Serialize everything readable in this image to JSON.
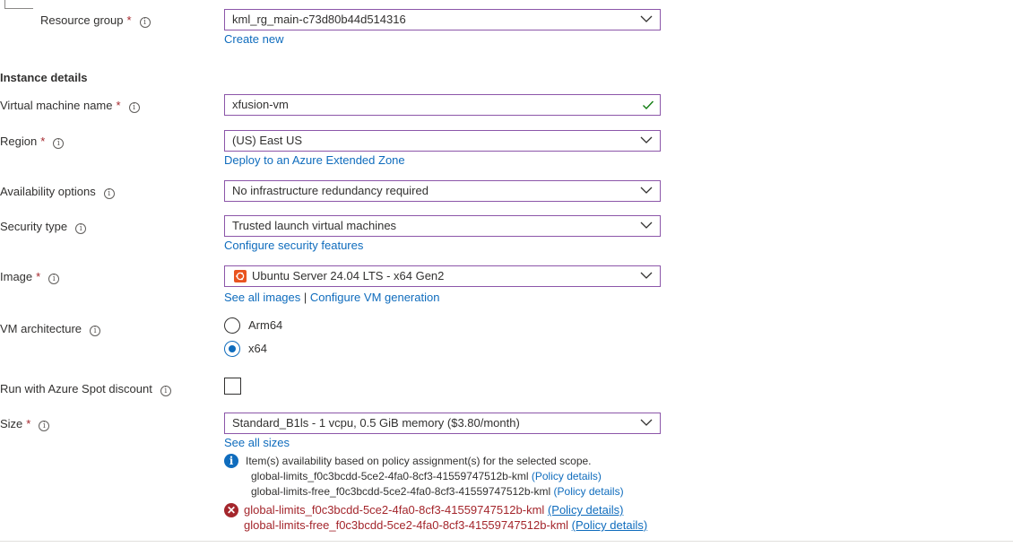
{
  "resource_group": {
    "label": "Resource group",
    "required_mark": "*",
    "value": "kml_rg_main-c73d80b44d514316",
    "create_new": "Create new"
  },
  "instance_details": {
    "title": "Instance details"
  },
  "vm_name": {
    "label": "Virtual machine name",
    "required_mark": "*",
    "value": "xfusion-vm"
  },
  "region": {
    "label": "Region",
    "required_mark": "*",
    "value": "(US) East US",
    "link": "Deploy to an Azure Extended Zone"
  },
  "availability": {
    "label": "Availability options",
    "value": "No infrastructure redundancy required"
  },
  "security_type": {
    "label": "Security type",
    "value": "Trusted launch virtual machines",
    "link": "Configure security features"
  },
  "image": {
    "label": "Image",
    "required_mark": "*",
    "value": "Ubuntu Server 24.04 LTS - x64 Gen2",
    "link_all": "See all images",
    "separator": "|",
    "link_config": "Configure VM generation"
  },
  "vm_architecture": {
    "label": "VM architecture",
    "options": [
      {
        "label": "Arm64",
        "selected": false
      },
      {
        "label": "x64",
        "selected": true
      }
    ]
  },
  "spot": {
    "label": "Run with Azure Spot discount",
    "checked": false
  },
  "size": {
    "label": "Size",
    "required_mark": "*",
    "value": "Standard_B1ls - 1 vcpu, 0.5 GiB memory ($3.80/month)",
    "link": "See all sizes"
  },
  "info_message": {
    "text": "Item(s) availability based on policy assignment(s) for the selected scope.",
    "lines": [
      {
        "name": "global-limits_f0c3bcdd-5ce2-4fa0-8cf3-41559747512b-kml",
        "link": "(Policy details)"
      },
      {
        "name": "global-limits-free_f0c3bcdd-5ce2-4fa0-8cf3-41559747512b-kml",
        "link": "(Policy details)"
      }
    ]
  },
  "error_message": {
    "lines": [
      {
        "name": "global-limits_f0c3bcdd-5ce2-4fa0-8cf3-41559747512b-kml",
        "link": "(Policy details)"
      },
      {
        "name": "global-limits-free_f0c3bcdd-5ce2-4fa0-8cf3-41559747512b-kml",
        "link": "(Policy details)"
      }
    ]
  },
  "info_glyph": "i",
  "error_glyph": "✕",
  "colors": {
    "accent": "#8c56a9",
    "link": "#0f6cbd",
    "error": "#a4262c",
    "success": "#107c10",
    "ubuntu": "#e95420"
  }
}
